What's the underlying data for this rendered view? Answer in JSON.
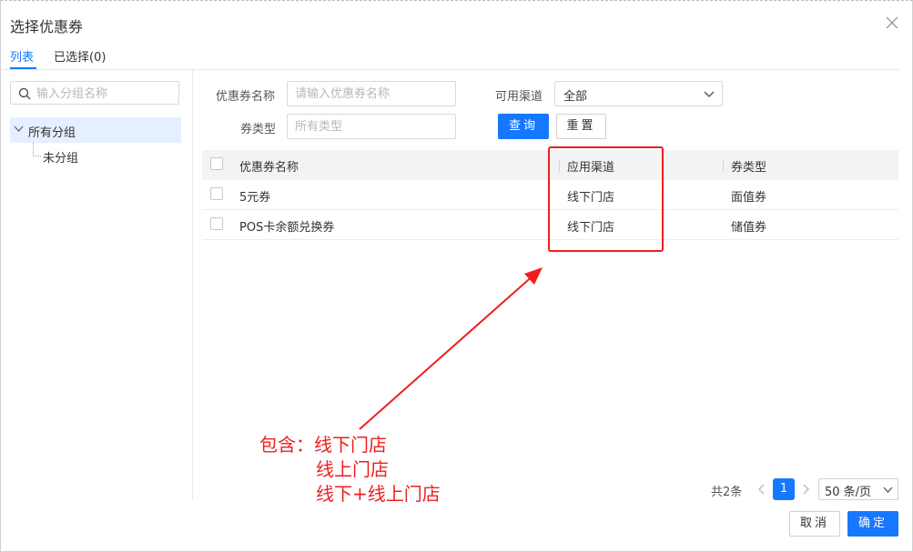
{
  "dialog": {
    "title": "选择优惠券"
  },
  "tabs": [
    {
      "label": "列表",
      "active": true
    },
    {
      "label": "已选择(0)",
      "active": false
    }
  ],
  "group_panel": {
    "search_placeholder": "输入分组名称",
    "tree": {
      "root_label": "所有分组",
      "children": [
        "未分组"
      ]
    }
  },
  "filters": {
    "name_label": "优惠券名称",
    "name_placeholder": "请输入优惠券名称",
    "channel_label": "可用渠道",
    "channel_value": "全部",
    "type_label": "券类型",
    "type_placeholder": "所有类型",
    "query_button": "查询",
    "reset_button": "重置"
  },
  "table": {
    "columns": [
      "优惠券名称",
      "应用渠道",
      "券类型"
    ],
    "rows": [
      {
        "name": "5元券",
        "channel": "线下门店",
        "type": "面值券"
      },
      {
        "name": "POS卡余额兑换券",
        "channel": "线下门店",
        "type": "储值券"
      }
    ]
  },
  "annotation": {
    "lines": [
      "包含：线下门店",
      "线上门店",
      "线下+线上门店"
    ],
    "color": "#f01e1e"
  },
  "pagination": {
    "total": "共2条",
    "current_page": "1",
    "page_size": "50 条/页"
  },
  "footer": {
    "cancel_button": "取消",
    "confirm_button": "确定"
  },
  "colors": {
    "accent": "#1677ff",
    "annotation_red": "#f01e1e"
  }
}
